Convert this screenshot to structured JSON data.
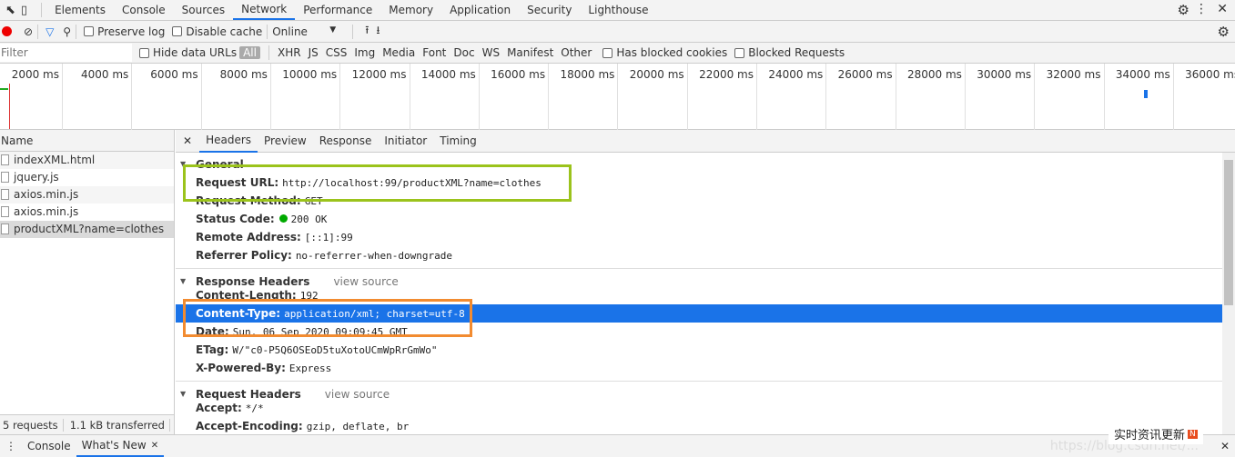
{
  "tabs": [
    "Elements",
    "Console",
    "Sources",
    "Network",
    "Performance",
    "Memory",
    "Application",
    "Security",
    "Lighthouse"
  ],
  "active_tab": "Network",
  "toolbar": {
    "preserve_log": "Preserve log",
    "disable_cache": "Disable cache",
    "throttle": "Online"
  },
  "filter": {
    "placeholder": "Filter",
    "hide_data_urls": "Hide data URLs",
    "types": [
      "All",
      "XHR",
      "JS",
      "CSS",
      "Img",
      "Media",
      "Font",
      "Doc",
      "WS",
      "Manifest",
      "Other"
    ],
    "has_blocked": "Has blocked cookies",
    "blocked_requests": "Blocked Requests"
  },
  "timeline": [
    "2000 ms",
    "4000 ms",
    "6000 ms",
    "8000 ms",
    "10000 ms",
    "12000 ms",
    "14000 ms",
    "16000 ms",
    "18000 ms",
    "20000 ms",
    "22000 ms",
    "24000 ms",
    "26000 ms",
    "28000 ms",
    "30000 ms",
    "32000 ms",
    "34000 ms",
    "36000 ms"
  ],
  "names": {
    "header": "Name",
    "items": [
      "indexXML.html",
      "jquery.js",
      "axios.min.js",
      "axios.min.js",
      "productXML?name=clothes"
    ],
    "selected": 4
  },
  "status": {
    "requests": "5 requests",
    "transferred": "1.1 kB transferred"
  },
  "detail": {
    "tabs": [
      "Headers",
      "Preview",
      "Response",
      "Initiator",
      "Timing"
    ],
    "general": {
      "title": "General",
      "rows": [
        [
          "Request URL:",
          "http://localhost:99/productXML?name=clothes"
        ],
        [
          "Request Method:",
          "GET"
        ],
        [
          "Status Code:",
          "200 OK"
        ],
        [
          "Remote Address:",
          "[::1]:99"
        ],
        [
          "Referrer Policy:",
          "no-referrer-when-downgrade"
        ]
      ]
    },
    "response": {
      "title": "Response Headers",
      "view_source": "view source",
      "rows": [
        [
          "Content-Length:",
          "192"
        ],
        [
          "Content-Type:",
          "application/xml; charset=utf-8"
        ],
        [
          "Date:",
          "Sun, 06 Sep 2020 09:09:45 GMT"
        ],
        [
          "ETag:",
          "W/\"c0-P5Q6OSEoD5tuXotoUCmWpRrGmWo\""
        ],
        [
          "X-Powered-By:",
          "Express"
        ]
      ]
    },
    "request": {
      "title": "Request Headers",
      "view_source": "view source",
      "rows": [
        [
          "Accept:",
          "*/*"
        ],
        [
          "Accept-Encoding:",
          "gzip, deflate, br"
        ]
      ]
    }
  },
  "drawer": {
    "tabs": [
      "Console",
      "What's New"
    ]
  },
  "watermark": "https://blog.csdn.net/...",
  "ad_text": "实时资讯更新",
  "colors": {
    "accent": "#1a73e8",
    "green_box": "#9bc31c",
    "orange_box": "#f28b30",
    "record": "#e00"
  }
}
